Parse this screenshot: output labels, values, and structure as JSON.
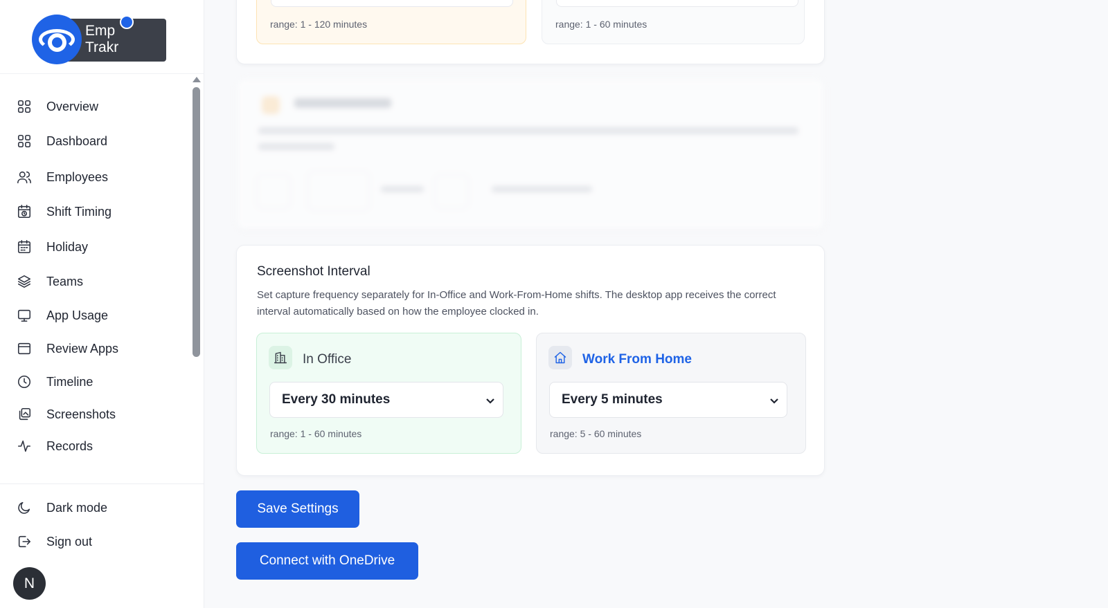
{
  "brand": {
    "line1": "Emp",
    "line2": "Trakr"
  },
  "sidebar": {
    "items": [
      {
        "label": "Overview",
        "icon": "grid-icon"
      },
      {
        "label": "Dashboard",
        "icon": "grid-icon"
      },
      {
        "label": "Employees",
        "icon": "users-icon"
      },
      {
        "label": "Shift Timing",
        "icon": "calendar-clock-icon"
      },
      {
        "label": "Holiday",
        "icon": "calendar-icon"
      },
      {
        "label": "Teams",
        "icon": "layers-icon"
      },
      {
        "label": "App Usage",
        "icon": "monitor-icon"
      },
      {
        "label": "Review Apps",
        "icon": "window-icon"
      },
      {
        "label": "Timeline",
        "icon": "clock-icon"
      },
      {
        "label": "Screenshots",
        "icon": "gallery-icon"
      },
      {
        "label": "Records",
        "icon": "activity-icon"
      }
    ],
    "dark_mode": "Dark mode",
    "sign_out": "Sign out",
    "avatar_initial": "N"
  },
  "top_card": {
    "left_range": "range: 1 - 120 minutes",
    "right_range": "range: 1 - 60 minutes"
  },
  "screenshot_interval": {
    "title": "Screenshot Interval",
    "description": "Set capture frequency separately for In-Office and Work-From-Home shifts. The desktop app receives the correct interval automatically based on how the employee clocked in.",
    "in_office": {
      "label": "In Office",
      "selected": "Every 30 minutes",
      "range": "range: 1 - 60 minutes"
    },
    "work_from_home": {
      "label": "Work From Home",
      "selected": "Every 5 minutes",
      "range": "range: 5 - 60 minutes"
    }
  },
  "buttons": {
    "save": "Save Settings",
    "onedrive": "Connect with OneDrive"
  },
  "colors": {
    "primary": "#1f5fe0",
    "office_bg": "#f0fcf5",
    "home_accent": "#1f63e6",
    "warning_bg": "#fff9ef"
  }
}
